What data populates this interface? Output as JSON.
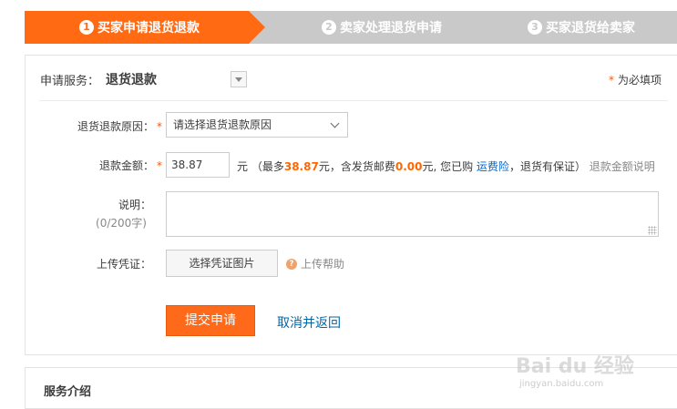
{
  "steps": [
    {
      "number": "1",
      "label": "买家申请退货退款"
    },
    {
      "number": "2",
      "label": "卖家处理退货申请"
    },
    {
      "number": "3",
      "label": "买家退货给卖家"
    }
  ],
  "service": {
    "label": "申请服务：",
    "value": "退货退款",
    "required_mark": "*",
    "required_note": "为必填项"
  },
  "form": {
    "reason_label": "退货退款原因：",
    "reason_placeholder": "请选择退货退款原因",
    "amount_label": "退款金额：",
    "amount_value": "38.87",
    "amount_unit": "元",
    "amount_info_prefix": "（最多",
    "amount_max": "38.87",
    "amount_info_mid": "元，含发货邮费",
    "amount_shipping": "0.00",
    "amount_info_mid2": "元, 您已购",
    "freight_insurance_link": "运费险",
    "amount_info_suffix": "，退货有保证）",
    "amount_help_link": "退款金额说明",
    "desc_label": "说明：",
    "desc_counter": "(0/200字)",
    "upload_label": "上传凭证：",
    "upload_button": "选择凭证图片",
    "upload_help": "上传帮助",
    "help_icon_glyph": "?",
    "submit_button": "提交申请",
    "cancel_link": "取消并返回"
  },
  "intro": {
    "title": "服务介绍"
  },
  "watermark": {
    "main": "Bai du 经验",
    "sub": "jingyan.baidu.com"
  },
  "colors": {
    "accent": "#ff6a12",
    "step_inactive": "#c9c9c9",
    "link": "#0066cc",
    "required": "#ff5500"
  }
}
